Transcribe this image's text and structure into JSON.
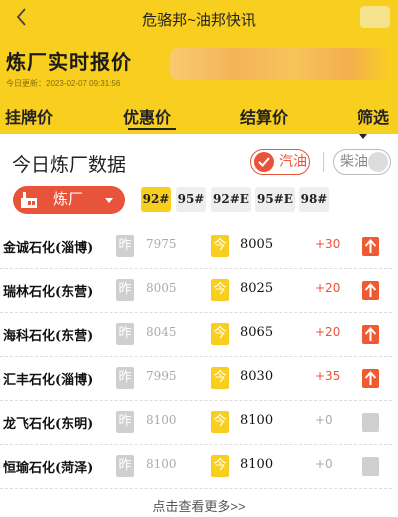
{
  "topbar": {
    "title": "危骆邦~油邦快讯"
  },
  "header": {
    "title": "炼厂实时报价",
    "updated": "今日更新：2023-02-07 09:31:56"
  },
  "tabs": [
    {
      "label": "挂牌价"
    },
    {
      "label": "优惠价",
      "active": true
    },
    {
      "label": "结算价"
    },
    {
      "label": "筛选"
    }
  ],
  "section": {
    "title": "今日炼厂数据"
  },
  "fuel": {
    "gasoline": "汽油",
    "diesel": "柴油",
    "selected": "汽油"
  },
  "refinery_filter": {
    "label": "炼厂"
  },
  "grades": [
    {
      "label": "92#",
      "active": true
    },
    {
      "label": "95#"
    },
    {
      "label": "92#E"
    },
    {
      "label": "95#E"
    },
    {
      "label": "98#"
    }
  ],
  "badges": {
    "yesterday": "昨",
    "today": "今"
  },
  "rows": [
    {
      "name": "金诚石化(淄博)",
      "yesterday": "7975",
      "today": "8005",
      "change": "+30",
      "trend": "up"
    },
    {
      "name": "瑞林石化(东营)",
      "yesterday": "8005",
      "today": "8025",
      "change": "+20",
      "trend": "up"
    },
    {
      "name": "海科石化(东营)",
      "yesterday": "8045",
      "today": "8065",
      "change": "+20",
      "trend": "up"
    },
    {
      "name": "汇丰石化(淄博)",
      "yesterday": "7995",
      "today": "8030",
      "change": "+35",
      "trend": "up"
    },
    {
      "name": "龙飞石化(东明)",
      "yesterday": "8100",
      "today": "8100",
      "change": "+0",
      "trend": "flat"
    },
    {
      "name": "恒瑜石化(菏泽)",
      "yesterday": "8100",
      "today": "8100",
      "change": "+0",
      "trend": "flat"
    }
  ],
  "more": {
    "label": "点击查看更多>>"
  },
  "colors": {
    "brand_yellow": "#f9cf1f",
    "accent_red": "#e8543a",
    "up_red": "#ef5a32",
    "muted": "#cfcfcf"
  }
}
